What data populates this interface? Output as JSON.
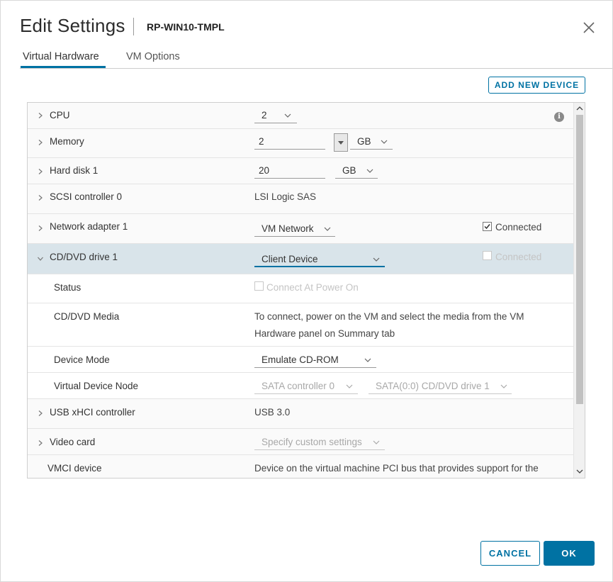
{
  "dialog": {
    "title": "Edit Settings",
    "subtitle": "RP-WIN10-TMPL"
  },
  "tabs": [
    {
      "label": "Virtual Hardware"
    },
    {
      "label": "VM Options"
    }
  ],
  "toolbar": {
    "add_device_label": "ADD NEW DEVICE"
  },
  "rows": {
    "cpu": {
      "label": "CPU",
      "value": "2"
    },
    "memory": {
      "label": "Memory",
      "value": "2",
      "unit": "GB"
    },
    "hard_disk": {
      "label": "Hard disk 1",
      "value": "20",
      "unit": "GB"
    },
    "scsi": {
      "label": "SCSI controller 0",
      "value": "LSI Logic SAS"
    },
    "network": {
      "label": "Network adapter 1",
      "value": "VM Network",
      "connected_label": "Connected",
      "connected": true
    },
    "cddvd": {
      "label": "CD/DVD drive 1",
      "value": "Client Device",
      "connected_label": "Connected",
      "connected": false
    },
    "status": {
      "label": "Status",
      "value": "Connect At Power On"
    },
    "media": {
      "label": "CD/DVD Media",
      "line1": "To connect, power on the VM and select the media from the VM",
      "line2": "Hardware panel on Summary tab"
    },
    "device_mode": {
      "label": "Device Mode",
      "value": "Emulate CD-ROM"
    },
    "vdn": {
      "label": "Virtual Device Node",
      "controller": "SATA controller 0",
      "node": "SATA(0:0) CD/DVD drive 1"
    },
    "usb": {
      "label": "USB xHCI controller",
      "value": "USB 3.0"
    },
    "video": {
      "label": "Video card",
      "value": "Specify custom settings"
    },
    "vmci": {
      "label": "VMCI device",
      "value": "Device on the virtual machine PCI bus that provides support for the"
    }
  },
  "footer": {
    "cancel_label": "CANCEL",
    "ok_label": "OK"
  },
  "colors": {
    "accent": "#0072a3",
    "selected_row": "#d9e4ea"
  }
}
